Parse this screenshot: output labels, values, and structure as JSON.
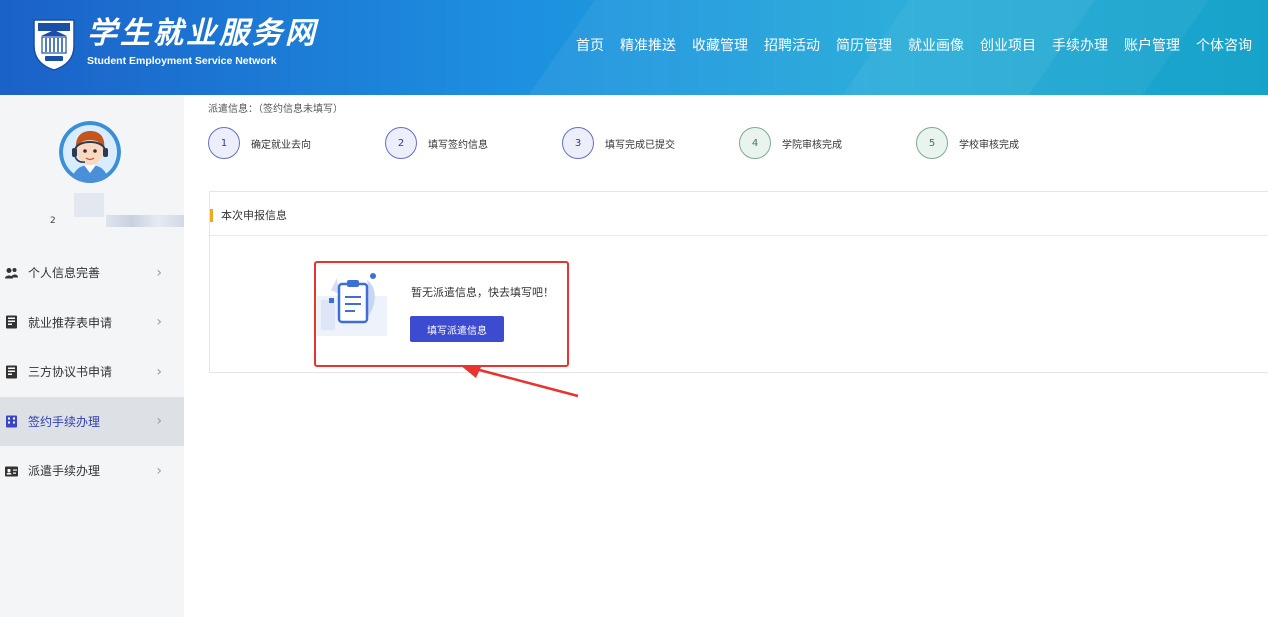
{
  "header": {
    "site_title": "学生就业服务网",
    "site_subtitle": "Student Employment Service Network",
    "nav": [
      "首页",
      "精准推送",
      "收藏管理",
      "招聘活动",
      "简历管理",
      "就业画像",
      "创业项目",
      "手续办理",
      "账户管理",
      "个体咨询"
    ]
  },
  "sidebar": {
    "user_name_prefix": "2",
    "items": [
      {
        "label": "个人信息完善",
        "icon": "person-icon"
      },
      {
        "label": "就业推荐表申请",
        "icon": "document-icon"
      },
      {
        "label": "三方协议书申请",
        "icon": "document-icon"
      },
      {
        "label": "签约手续办理",
        "icon": "building-icon",
        "active": true
      },
      {
        "label": "派遣手续办理",
        "icon": "id-card-icon"
      }
    ]
  },
  "dispatch": {
    "title": "派遣信息：（签约信息未填写）",
    "steps": [
      {
        "num": "1",
        "label": "确定就业去向",
        "status": "current"
      },
      {
        "num": "2",
        "label": "填写签约信息",
        "status": "current"
      },
      {
        "num": "3",
        "label": "填写完成已提交",
        "status": "current"
      },
      {
        "num": "4",
        "label": "学院审核完成",
        "status": "pending"
      },
      {
        "num": "5",
        "label": "学校审核完成",
        "status": "pending"
      }
    ]
  },
  "card": {
    "title": "本次申报信息",
    "empty_text": "暂无派遣信息，快去填写吧！",
    "button_label": "填写派遣信息"
  },
  "colors": {
    "header_start": "#1b61c8",
    "header_end": "#17a3c9",
    "primary": "#3d4bd1",
    "accent_bar": "#f0a81d",
    "annotation": "#e8332e"
  }
}
